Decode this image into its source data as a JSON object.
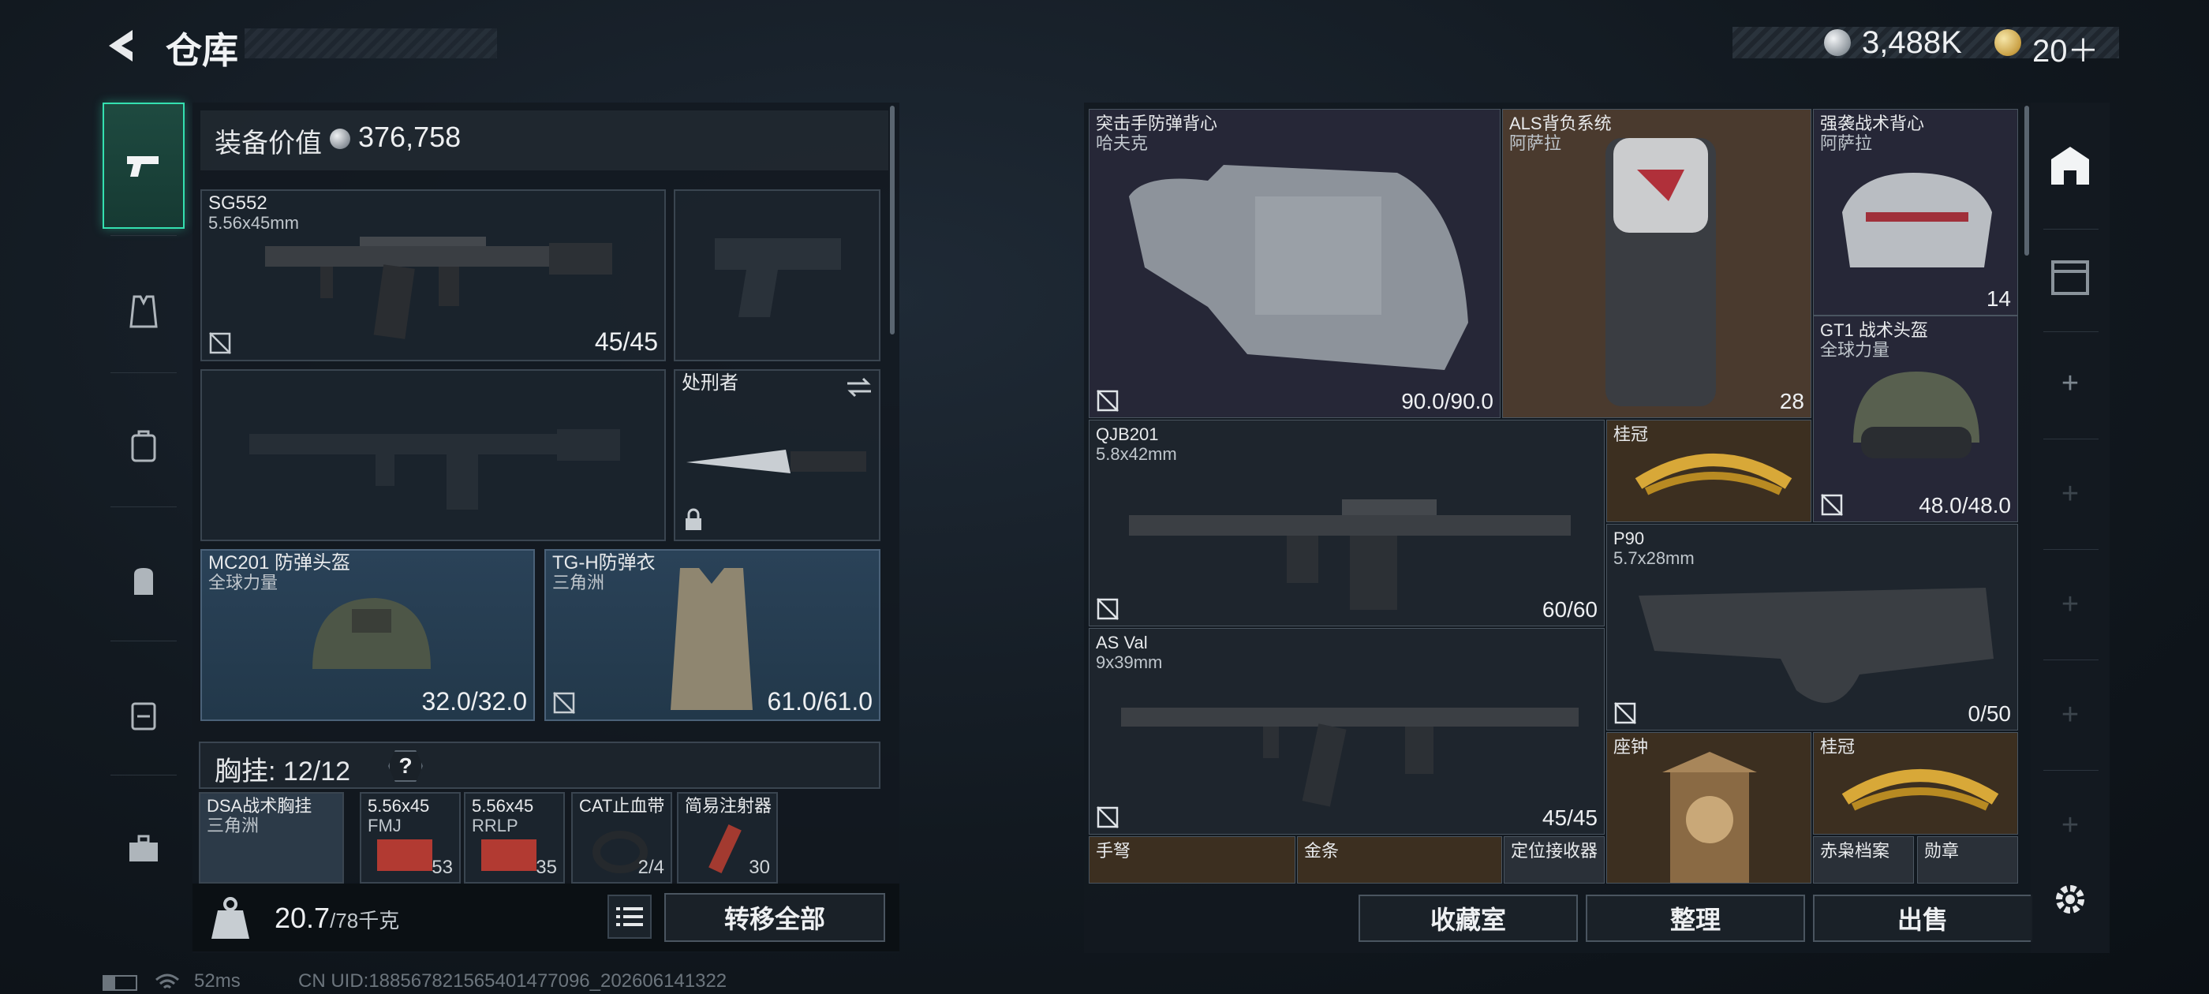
{
  "header": {
    "title": "仓库",
    "silver": "3,488K",
    "gold": "20＋"
  },
  "equip": {
    "value_label": "装备价值",
    "value": "376,758"
  },
  "loadout": {
    "primary": {
      "name": "SG552",
      "sub": "5.56x45mm",
      "ammo": "45/45"
    },
    "melee": {
      "name": "处刑者"
    },
    "helmet": {
      "name": "MC201 防弹头盔",
      "sub": "全球力量",
      "value": "32.0/32.0"
    },
    "armor": {
      "name": "TG-H防弹衣",
      "sub": "三角洲",
      "value": "61.0/61.0"
    }
  },
  "rig": {
    "label": "胸挂:",
    "count": "12/12",
    "help": "?",
    "items": [
      {
        "name": "DSA战术胸挂",
        "sub": "三角洲",
        "val": ""
      },
      {
        "name": "5.56x45",
        "sub": "FMJ",
        "val": "53"
      },
      {
        "name": "5.56x45",
        "sub": "RRLP",
        "val": "35"
      },
      {
        "name": "CAT止血带",
        "sub": "",
        "val": "2/4"
      },
      {
        "name": "简易注射器",
        "sub": "",
        "val": "30"
      }
    ]
  },
  "weight": {
    "value": "20.7",
    "max": "/78千克"
  },
  "transfer_label": "转移全部",
  "stash": {
    "vest1": {
      "name": "突击手防弹背心",
      "sub": "哈夫克",
      "value": "90.0/90.0"
    },
    "backpack1": {
      "name": "ALS背负系统",
      "sub": "阿萨拉",
      "value": "28"
    },
    "backpack2": {
      "name": "强袭战术背心",
      "sub": "阿萨拉",
      "value": "14"
    },
    "helmet2": {
      "name": "GT1 战术头盔",
      "sub": "全球力量",
      "value": "48.0/48.0"
    },
    "gun1": {
      "name": "QJB201",
      "sub": "5.8x42mm",
      "value": "60/60"
    },
    "crown1": {
      "name": "桂冠"
    },
    "gun2": {
      "name": "P90",
      "sub": "5.7x28mm",
      "value": "0/50"
    },
    "gun3": {
      "name": "AS Val",
      "sub": "9x39mm",
      "value": "45/45"
    },
    "clock": {
      "name": "座钟"
    },
    "crown2": {
      "name": "桂冠"
    },
    "row_bottom": [
      "手弩",
      "金条",
      "定位接收器",
      "赤枭档案",
      "勋章"
    ]
  },
  "buttons": {
    "collection": "收藏室",
    "sort": "整理",
    "sell": "出售"
  },
  "status": {
    "ping": "52ms",
    "uid": "CN UID:1885678215654014770​96_202606141322"
  },
  "colors": {
    "accent": "#34e0b0",
    "panel": "#121920"
  }
}
